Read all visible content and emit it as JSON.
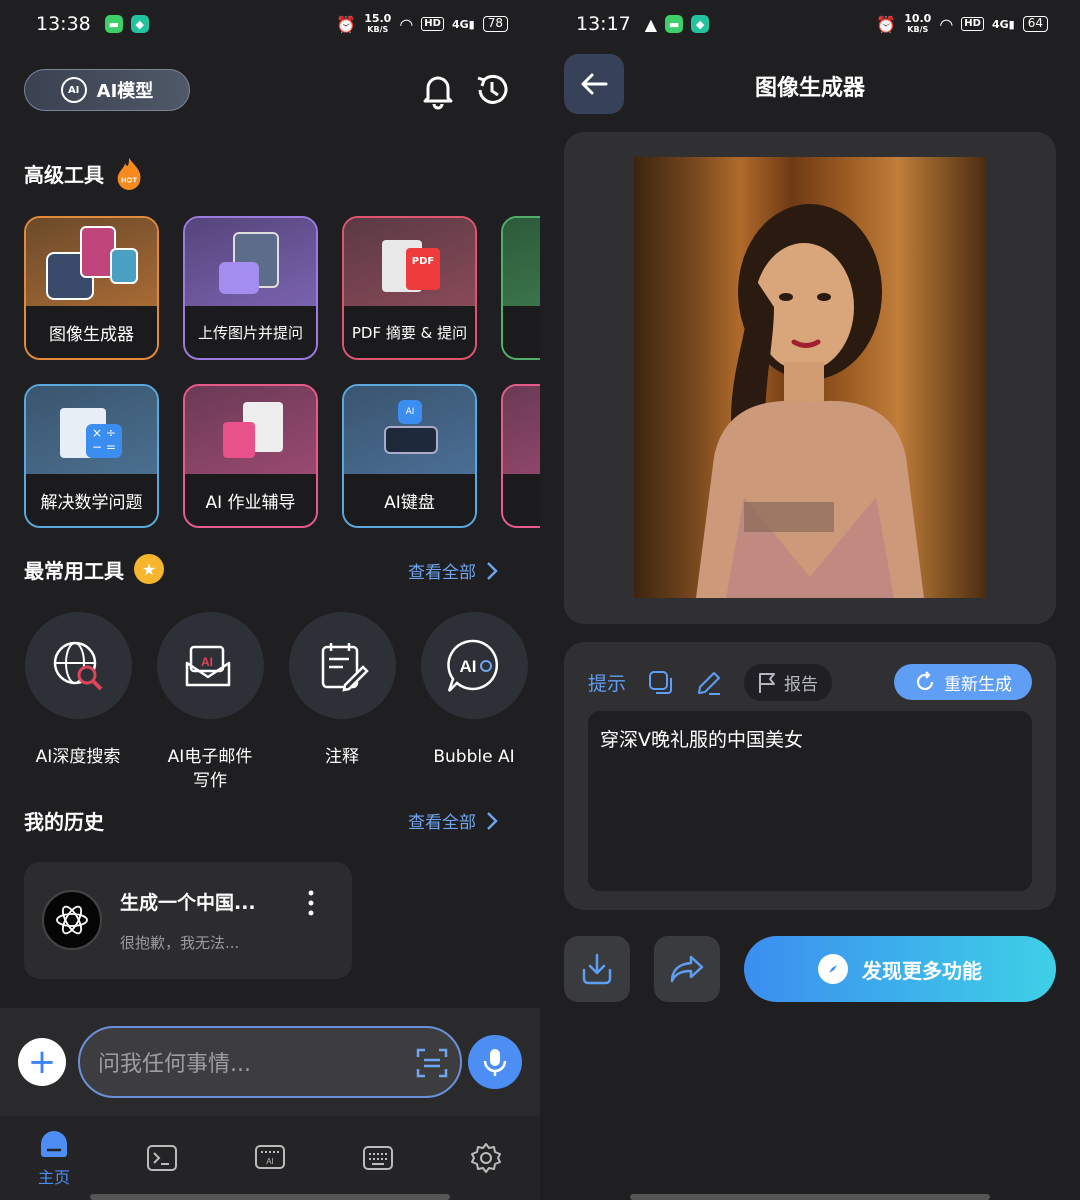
{
  "left": {
    "status": {
      "time": "13:38",
      "speed_value": "15.0",
      "speed_unit": "KB/S",
      "hd": "HD",
      "signal": "4G",
      "battery": "78"
    },
    "ai_model_button": {
      "label": "AI模型"
    },
    "advanced_tools": {
      "title": "高级工具",
      "badge": "HOT",
      "cards": [
        {
          "label": "图像生成器",
          "border": "#e08a3a"
        },
        {
          "label": "上传图片并提问",
          "border": "#9b7be0"
        },
        {
          "label": "PDF 摘要 & 提问",
          "border": "#e0556e"
        },
        {
          "label": "解决数学问题",
          "border": "#5aa8dc"
        },
        {
          "label": "AI 作业辅导",
          "border": "#e65b8a"
        },
        {
          "label": "AI键盘",
          "border": "#5aa8dc"
        }
      ]
    },
    "frequent_tools": {
      "title": "最常用工具",
      "see_all": "查看全部",
      "items": [
        {
          "label": "AI深度搜索",
          "icon": "globe-search-icon"
        },
        {
          "label": "AI电子邮件写作",
          "icon": "ai-email-icon"
        },
        {
          "label": "注释",
          "icon": "notes-icon"
        },
        {
          "label": "Bubble AI",
          "icon": "bubble-ai-icon"
        }
      ]
    },
    "history": {
      "title": "我的历史",
      "see_all": "查看全部",
      "items": [
        {
          "title": "生成一个中国...",
          "subtitle": "很抱歉，我无法..."
        }
      ]
    },
    "chat": {
      "placeholder": "问我任何事情..."
    },
    "nav": {
      "home_label": "主页",
      "active_color": "#4d8ef5"
    }
  },
  "right": {
    "status": {
      "time": "13:17",
      "speed_value": "10.0",
      "speed_unit": "KB/S",
      "hd": "HD",
      "signal": "4G",
      "battery": "64"
    },
    "title": "图像生成器",
    "prompt_section": {
      "tip_label": "提示",
      "report_label": "报告",
      "regenerate_label": "重新生成",
      "prompt_text": "穿深V晚礼服的中国美女"
    },
    "discover_label": "发现更多功能",
    "accent": "#5f9ef5"
  }
}
